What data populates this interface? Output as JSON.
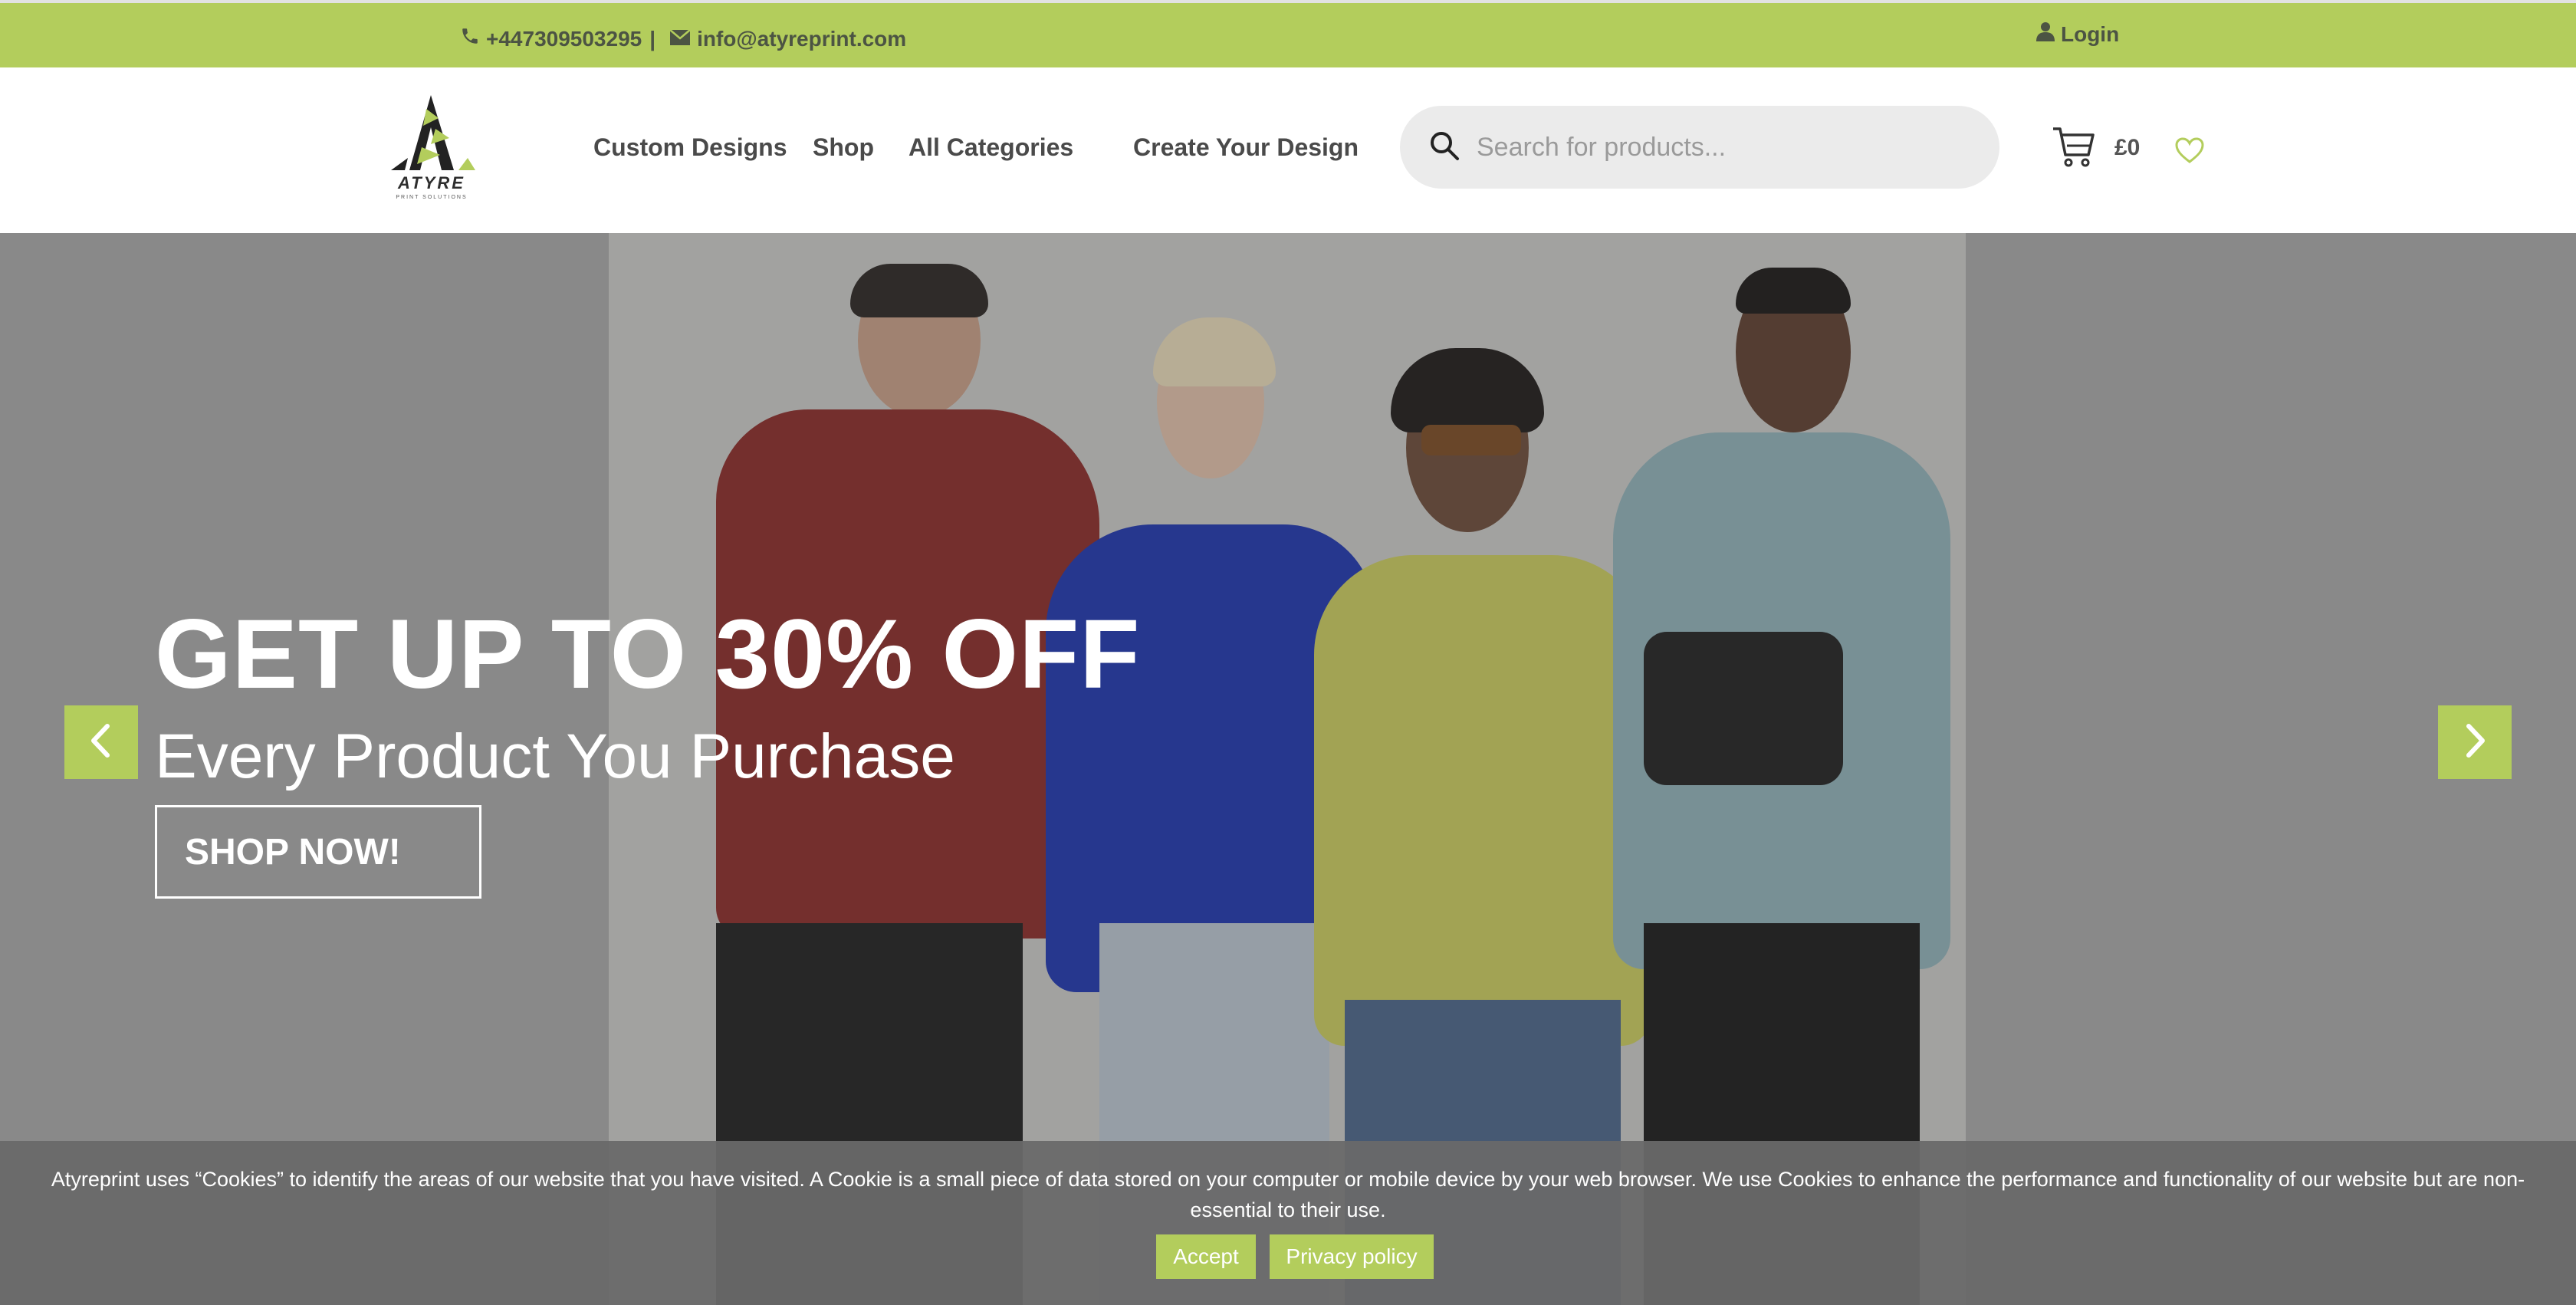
{
  "topbar": {
    "phone": "+447309503295",
    "separator": "|",
    "email": "info@atyreprint.com",
    "login": "Login"
  },
  "logo": {
    "word": "ATYRE",
    "sub": "PRINT SOLUTIONS"
  },
  "nav": {
    "custom_designs": "Custom Designs",
    "shop": "Shop",
    "all_categories": "All Categories",
    "create_your_design": "Create Your Design"
  },
  "search": {
    "placeholder": "Search for products..."
  },
  "cart": {
    "total": "£0"
  },
  "hero": {
    "title": "GET UP TO 30% OFF",
    "subtitle": "Every Product You Purchase",
    "button": "SHOP NOW!"
  },
  "cookie": {
    "message": "Atyreprint uses “Cookies” to identify the areas of our website that you have visited. A Cookie is a small piece of data stored on your computer or mobile device by your web browser. We use Cookies to enhance the performance and functionality of our website but are non-essential to their use.",
    "accept": "Accept",
    "privacy": "Privacy policy"
  },
  "colors": {
    "accent": "#b3cd5c",
    "topbar_text": "#4c5443"
  },
  "icons": [
    "phone-icon",
    "mail-icon",
    "user-icon",
    "search-icon",
    "cart-icon",
    "heart-icon",
    "chevron-left-icon",
    "chevron-right-icon",
    "close-icon"
  ]
}
